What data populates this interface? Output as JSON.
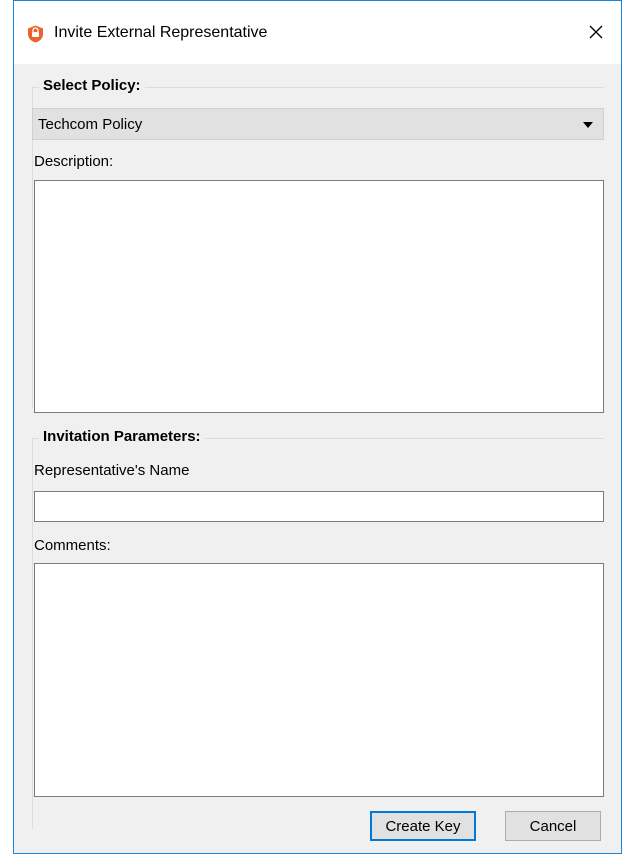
{
  "window": {
    "title": "Invite External Representative",
    "icon": "shield-app-icon",
    "close_icon": "close-icon"
  },
  "policy_group": {
    "title": "Select Policy:",
    "selected_policy": "Techcom Policy",
    "description_label": "Description:",
    "description_value": ""
  },
  "invitation_group": {
    "title": "Invitation Parameters:",
    "name_label": "Representative's Name",
    "name_value": "",
    "comments_label": "Comments:",
    "comments_value": ""
  },
  "buttons": {
    "create_key": "Create Key",
    "cancel": "Cancel"
  },
  "colors": {
    "window_border": "#1a86d9",
    "client_bg": "#f0f0f0",
    "default_button_border": "#0078d7",
    "app_icon": "#e8642c"
  }
}
